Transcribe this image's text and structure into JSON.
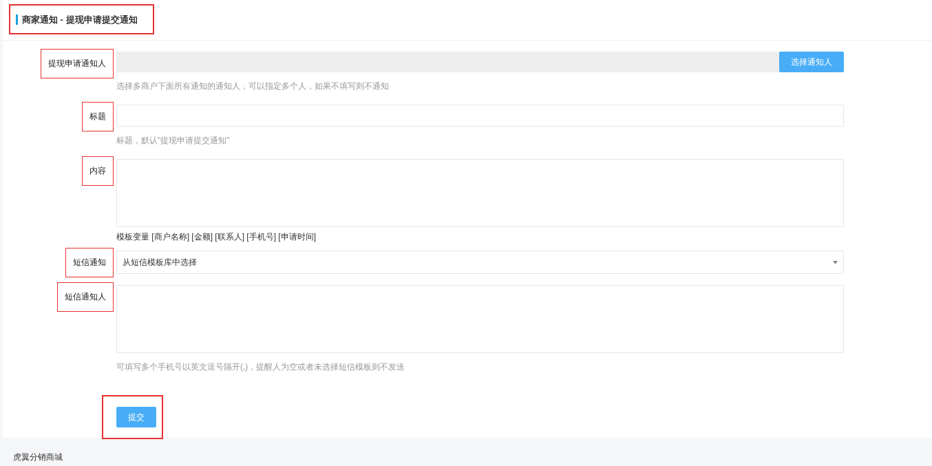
{
  "header": {
    "title": "商家通知 - 提现申请提交通知",
    "highlighted": true
  },
  "fields": [
    {
      "kind": "picker",
      "label": "提现申请通知人",
      "highlighted": true,
      "button": "选择通知人",
      "help": "选择多商户下面所有通知的通知人，可以指定多个人，如果不填写则不通知",
      "help_dark": false
    },
    {
      "kind": "input",
      "label": "标题",
      "highlighted": true,
      "help": "标题，默认\"提现申请提交通知\"",
      "help_dark": false
    },
    {
      "kind": "textarea",
      "label": "内容",
      "highlighted": true,
      "help": "模板变量 [商户名称] [金额] [联系人] [手机号] [申请时间]",
      "help_dark": true
    },
    {
      "kind": "select",
      "label": "短信通知",
      "highlighted": true,
      "value": "从短信模板库中选择"
    },
    {
      "kind": "textarea",
      "label": "短信通知人",
      "highlighted": true,
      "help": "可填写多个手机号以英文逗号隔开(,)，提醒人为空或者未选择短信模板则不发送",
      "help_dark": false
    }
  ],
  "submit": {
    "label": "提交",
    "highlighted": true
  },
  "footer": {
    "text": "虎翼分销商城"
  }
}
